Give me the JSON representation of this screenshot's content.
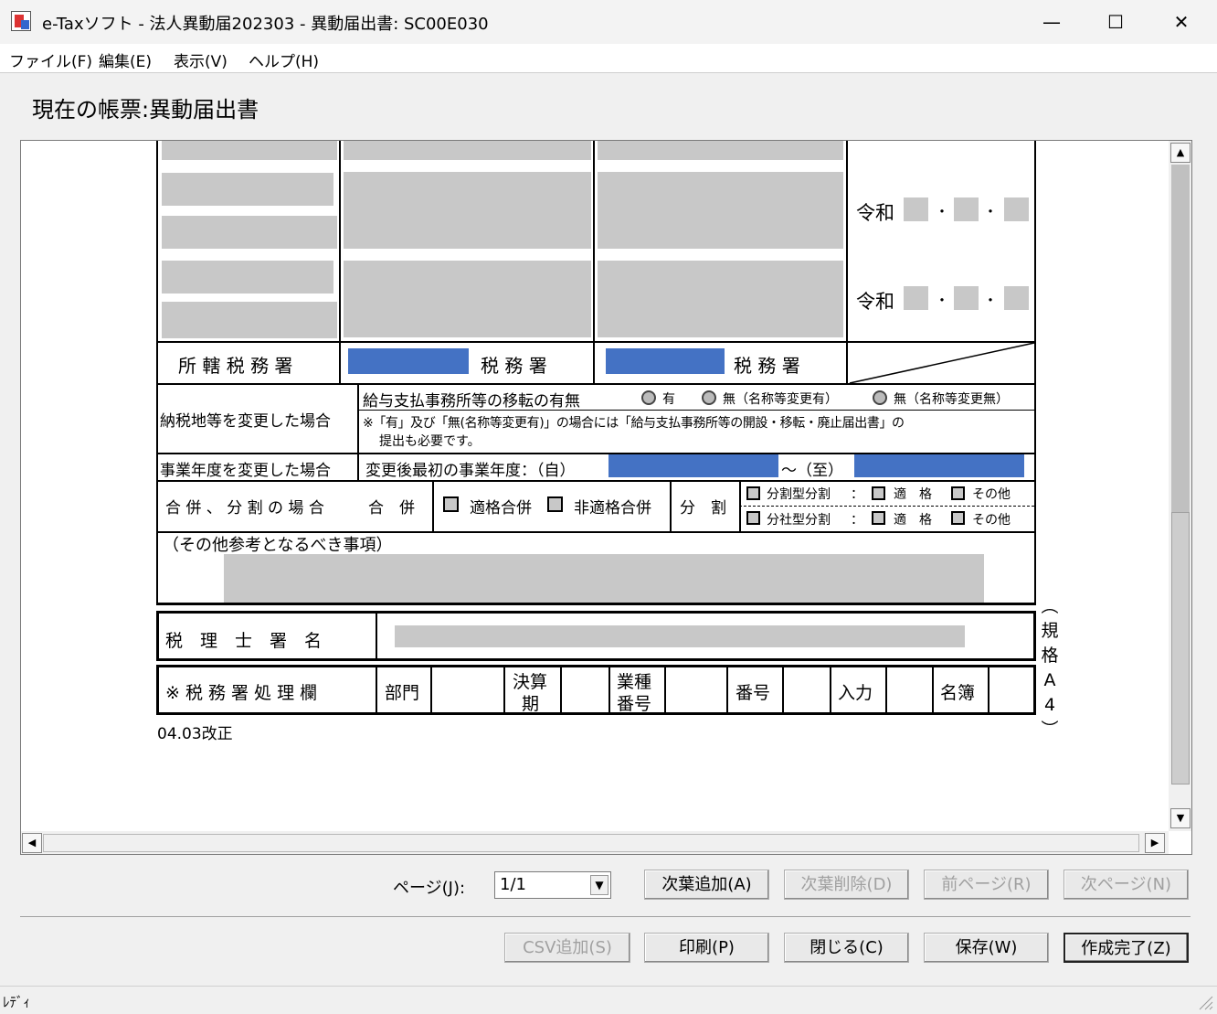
{
  "window": {
    "title": "e-Taxソフト - 法人異動届202303 - 異動届出書: SC00E030",
    "minimize_glyph": "—",
    "maximize_glyph": "☐",
    "close_glyph": "✕"
  },
  "menu": [
    "ファイル(F)",
    "編集(E)",
    "表示(V)",
    "ヘルプ(H)"
  ],
  "heading": "現在の帳票:異動届出書",
  "form": {
    "reiwa": "令和",
    "date_sep": "・",
    "tax_office_label": "所 轄 税 務 署",
    "tax_office_suffix": "税 務 署",
    "payment_change_label": "納税地等を変更した場合",
    "payroll_transfer_q": "給与支払事務所等の移転の有無",
    "opt_yes": "有",
    "opt_no_changed": "無（名称等変更有）",
    "opt_no_unchanged": "無（名称等変更無）",
    "note_line1": "※「有」及び「無(名称等変更有)」の場合には「給与支払事務所等の開設・移転・廃止届出書」の",
    "note_line2": "提出も必要です。",
    "fiscal_change_label": "事業年度を変更した場合",
    "fiscal_first_label": "変更後最初の事業年度：（自）",
    "fiscal_to": "～（至）",
    "merger_label": "合 併 、 分 割 の 場 合",
    "merger": "合　併",
    "qualified_merger": "適格合併",
    "nonqualified_merger": "非適格合併",
    "split": "分　割",
    "split_type1": "分割型分割",
    "split_type2": "分社型分割",
    "colon": "：",
    "qualified": "適　格",
    "other": "その他",
    "other_ref_label": "（その他参考となるべき事項）",
    "accountant_label": "税　理　士　署　名",
    "office_use_label": "※ 税 務 署 処 理 欄",
    "dept": "部門",
    "settlement_a": "決算",
    "settlement_b": "期",
    "industry_a": "業種",
    "industry_b": "番号",
    "number": "番号",
    "input": "入力",
    "register": "名簿",
    "side_note": [
      "︵",
      "規",
      "格",
      "A",
      "4",
      "︶"
    ],
    "revision": "04.03改正"
  },
  "footer": {
    "page_label": "ページ(J):",
    "page_value": "1/1",
    "buttons_row1": {
      "add_page": "次葉追加(A)",
      "delete_page": "次葉削除(D)",
      "prev_page": "前ページ(R)",
      "next_page": "次ページ(N)"
    },
    "buttons_row2": {
      "csv_add": "CSV追加(S)",
      "print": "印刷(P)",
      "close": "閉じる(C)",
      "save": "保存(W)",
      "complete": "作成完了(Z)"
    }
  },
  "status": "ﾚﾃﾞｨ"
}
